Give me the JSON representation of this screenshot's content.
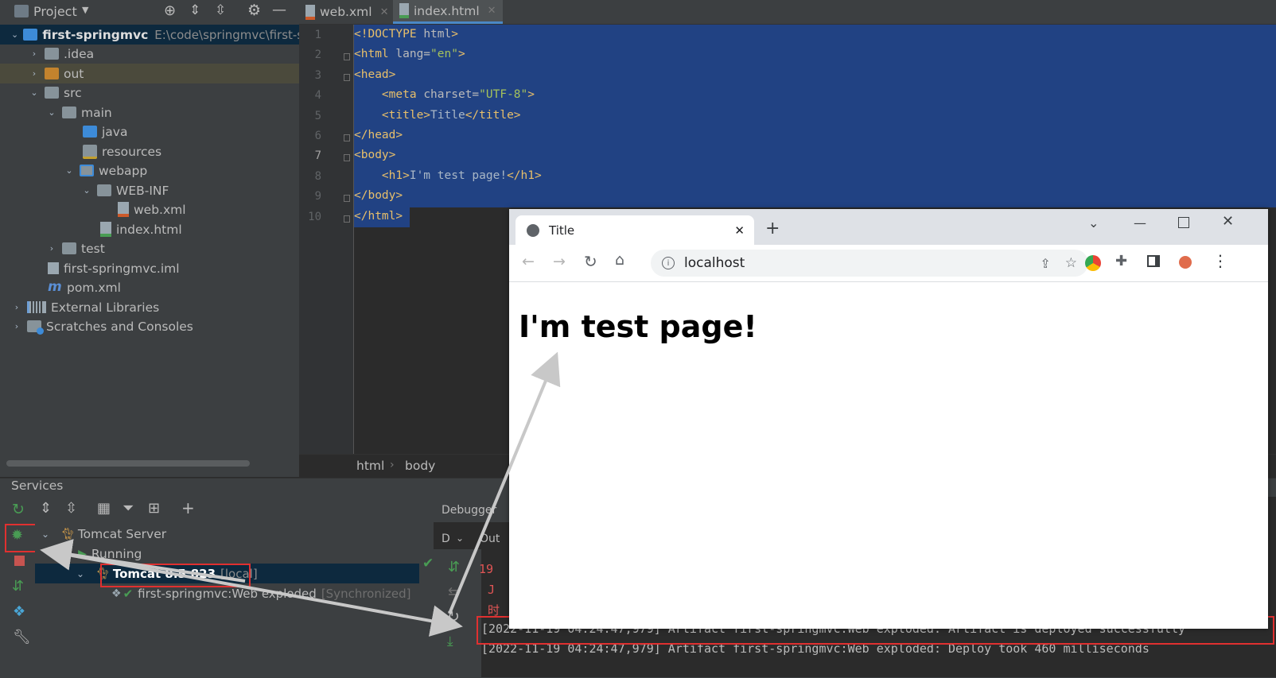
{
  "project_panel": {
    "title": "Project",
    "tree": [
      {
        "label": "first-springmvc",
        "path": "E:\\code\\springmvc\\first-sp",
        "level": 0,
        "expanded": true,
        "icon": "module-folder-icon",
        "bold": true
      },
      {
        "label": ".idea",
        "level": 1,
        "expanded": false,
        "icon": "folder-icon"
      },
      {
        "label": "out",
        "level": 1,
        "expanded": false,
        "icon": "folder-orange-icon",
        "highlighted": true
      },
      {
        "label": "src",
        "level": 1,
        "expanded": true,
        "icon": "folder-icon"
      },
      {
        "label": "main",
        "level": 2,
        "expanded": true,
        "icon": "folder-icon"
      },
      {
        "label": "java",
        "level": 3,
        "icon": "source-folder-icon"
      },
      {
        "label": "resources",
        "level": 3,
        "icon": "resources-folder-icon"
      },
      {
        "label": "webapp",
        "level": 3,
        "expanded": true,
        "icon": "web-folder-icon"
      },
      {
        "label": "WEB-INF",
        "level": 4,
        "expanded": true,
        "icon": "folder-icon"
      },
      {
        "label": "web.xml",
        "level": 5,
        "icon": "xml-file-icon"
      },
      {
        "label": "index.html",
        "level": 4,
        "icon": "html-file-icon"
      },
      {
        "label": "test",
        "level": 2,
        "expanded": false,
        "icon": "folder-icon"
      },
      {
        "label": "first-springmvc.iml",
        "level": 1,
        "icon": "iml-file-icon"
      },
      {
        "label": "pom.xml",
        "level": 1,
        "icon": "maven-file-icon"
      },
      {
        "label": "External Libraries",
        "level": 0,
        "expanded": false,
        "icon": "libraries-icon"
      },
      {
        "label": "Scratches and Consoles",
        "level": 0,
        "expanded": false,
        "icon": "scratches-icon"
      }
    ]
  },
  "editor": {
    "tabs": [
      {
        "label": "web.xml",
        "active": false
      },
      {
        "label": "index.html",
        "active": true
      }
    ],
    "line_numbers": [
      "1",
      "2",
      "3",
      "4",
      "5",
      "6",
      "7",
      "8",
      "9",
      "10"
    ],
    "lines": [
      [
        {
          "t": "tg",
          "v": "<!DOCTYPE "
        },
        {
          "t": "at",
          "v": "html"
        },
        {
          "t": "tg",
          "v": ">"
        }
      ],
      [
        {
          "t": "tg",
          "v": "<html "
        },
        {
          "t": "at",
          "v": "lang="
        },
        {
          "t": "av",
          "v": "\"en\""
        },
        {
          "t": "tg",
          "v": ">"
        }
      ],
      [
        {
          "t": "tg",
          "v": "<head>"
        }
      ],
      [
        {
          "t": "tx",
          "v": "    "
        },
        {
          "t": "tg",
          "v": "<meta "
        },
        {
          "t": "at",
          "v": "charset="
        },
        {
          "t": "av",
          "v": "\"UTF-8\""
        },
        {
          "t": "tg",
          "v": ">"
        }
      ],
      [
        {
          "t": "tx",
          "v": "    "
        },
        {
          "t": "tg",
          "v": "<title>"
        },
        {
          "t": "tx",
          "v": "Title"
        },
        {
          "t": "tg",
          "v": "</title>"
        }
      ],
      [
        {
          "t": "tg",
          "v": "</head>"
        }
      ],
      [
        {
          "t": "tg",
          "v": "<body>"
        }
      ],
      [
        {
          "t": "tx",
          "v": "    "
        },
        {
          "t": "tg",
          "v": "<h1>"
        },
        {
          "t": "tx",
          "v": "I'm test page!"
        },
        {
          "t": "tg",
          "v": "</h1>"
        }
      ],
      [
        {
          "t": "tg",
          "v": "</body>"
        }
      ],
      [
        {
          "t": "tg",
          "v": "</html>"
        }
      ]
    ],
    "breadcrumb": [
      "html",
      "body"
    ]
  },
  "services": {
    "title": "Services",
    "tree": {
      "server": "Tomcat Server",
      "status": "Running",
      "instance": "Tomcat 8.5.823",
      "instance_suffix": "[local]",
      "artifact": "first-springmvc:Web exploded",
      "artifact_suffix": "[Synchronized]"
    },
    "console_tabs": {
      "debugger": "Debugger",
      "d_tab": "D",
      "out_tab": "Out"
    },
    "console_lines": [
      "[2022-11-19 04:24:47,979] Artifact first-springmvc:Web exploded: Artifact is deployed successfully",
      "[2022-11-19 04:24:47,979] Artifact first-springmvc:Web exploded: Deploy took 460 milliseconds"
    ],
    "partial_red": "19",
    "partial_red2": "J",
    "partial_red3": "时"
  },
  "browser": {
    "tab_title": "Title",
    "address": "localhost",
    "page_heading": "I'm test page!"
  },
  "colors": {
    "selection": "#214283",
    "highlight_box": "#e03030",
    "run_green": "#499c54"
  }
}
